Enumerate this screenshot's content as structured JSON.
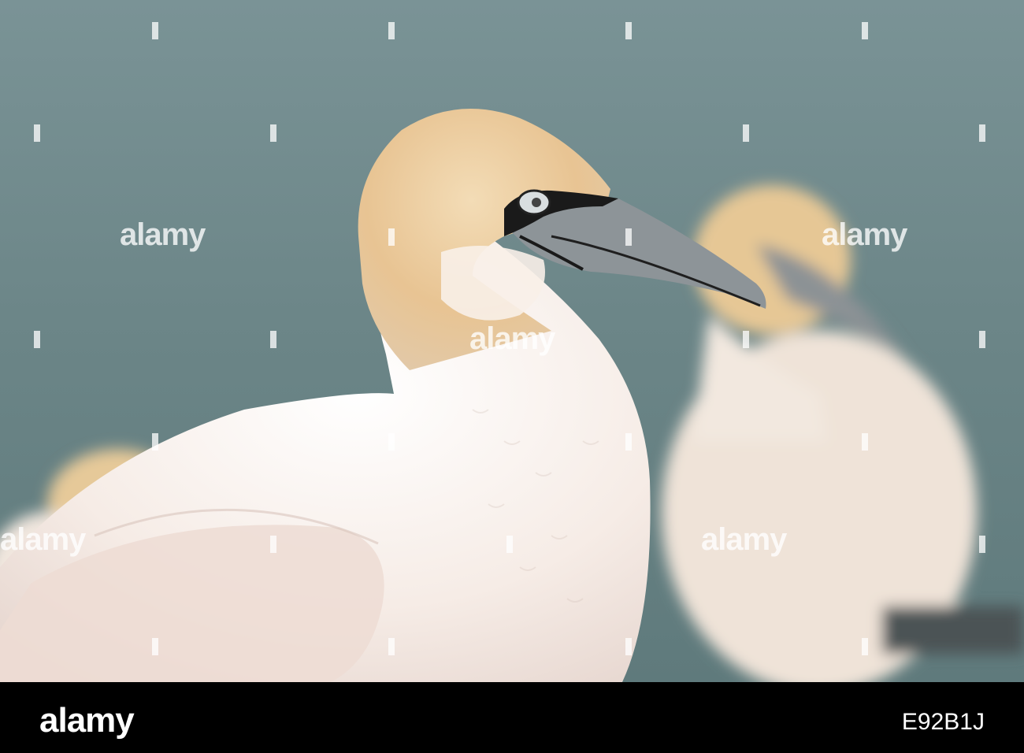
{
  "photo": {
    "subject": "northern-gannet",
    "colors": {
      "background": "#6f8a8d",
      "plumage": "#f5ece4",
      "head": "#e9c99a",
      "bill": "#8e9599",
      "mask": "#1a1a1a"
    }
  },
  "watermark": {
    "text": "alamy"
  },
  "footer": {
    "brand": "alamy",
    "image_id": "E92B1J"
  }
}
